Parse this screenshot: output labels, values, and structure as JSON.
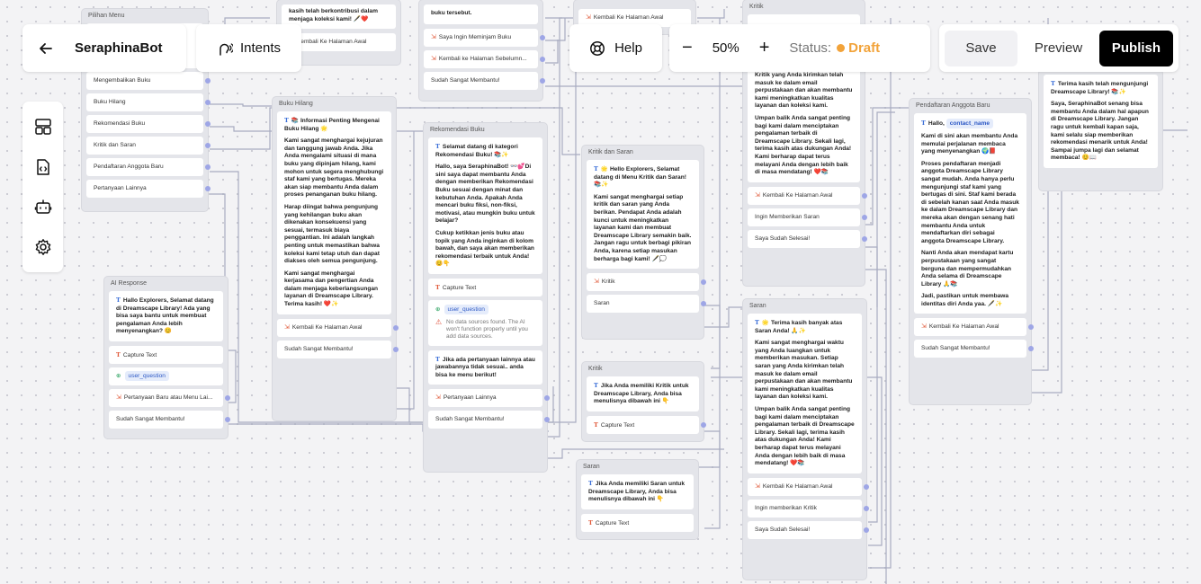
{
  "toolbar": {
    "back_icon": "arrow-left-icon",
    "bot_name": "SeraphinaBot",
    "intents_label": "Intents",
    "help_label": "Help",
    "zoom_minus": "−",
    "zoom_value": "50%",
    "zoom_plus": "+",
    "status_label": "Status:",
    "status_value": "Draft",
    "status_color": "#f2a33a",
    "save_label": "Save",
    "preview_label": "Preview",
    "publish_label": "Publish"
  },
  "rail": {
    "icons": [
      "layout-icon",
      "file-code-icon",
      "bot-icon",
      "gear-icon"
    ]
  },
  "nodes": {
    "pilihan_menu": {
      "title": "Pilihan Menu",
      "options": [
        "Mengembalikan Buku",
        "Buku Hilang",
        "Rekomendasi Buku",
        "Kritik dan Saran",
        "Pendaftaran Anggota Baru",
        "Pertanyaan Lainnya"
      ]
    },
    "top_a": {
      "text": "kasih telah berkontribusi dalam menjaga koleksi kami! 🖋️❤️",
      "option": "Kembali Ke Halaman Awal"
    },
    "top_b": {
      "text": "buku tersebut.",
      "options": [
        "Saya Ingin Meminjam Buku",
        "Kembali ke Halaman Sebelumn...",
        "Sudah Sangat Membantu!"
      ]
    },
    "top_c": {
      "option": "Kembali Ke Halaman Awal"
    },
    "top_d": {
      "title": "Kritik",
      "text_lines": [
        "Kritik yang Anda kirimkan telah masuk ke dalam email perpustakaan dan akan membantu kami meningkatkan kualitas layanan dan koleksi kami.",
        "Umpan balik Anda sangat penting bagi kami dalam menciptakan pengalaman terbaik di Dreamscape Library. Sekali lagi, terima kasih atas dukungan Anda! Kami berharap dapat terus melayani Anda dengan lebih baik di masa mendatang! ❤️📚"
      ],
      "options": [
        "Kembali Ke Halaman Awal",
        "Ingin Memberikan Saran",
        "Saya Sudah Selesai!"
      ]
    },
    "top_e": {
      "text": "Terima kasih telah mengunjungi Dreamscape Library! 📚✨",
      "text2": "Saya, SeraphinaBot senang bisa membantu Anda dalam hal apapun di Dreamscape Library. Jangan ragu untuk kembali kapan saja, kami selalu siap memberikan rekomendasi menarik untuk Anda! Sampai jumpa lagi dan selamat membaca! 😊📖"
    },
    "buku_hilang": {
      "title": "Buku Hilang",
      "text_lead": "📚 Informasi Penting Mengenai Buku Hilang 🌟",
      "paras": [
        "Kami sangat menghargai kejujuran dan tanggung jawab Anda. Jika Anda mengalami situasi di mana buku yang dipinjam hilang, kami mohon untuk segera menghubungi staf kami yang bertugas. Mereka akan siap membantu Anda dalam proses penanganan buku hilang.",
        "Harap diingat bahwa pengunjung yang kehilangan buku akan dikenakan konsekuensi yang sesuai, termasuk biaya penggantian. Ini adalah langkah penting untuk memastikan bahwa koleksi kami tetap utuh dan dapat diakses oleh semua pengunjung.",
        "Kami sangat menghargai kerjasama dan pengertian Anda dalam menjaga keberlangsungan layanan di Dreamscape Library. Terima kasih! ❤️✨"
      ],
      "options": [
        "Kembali Ke Halaman Awal",
        "Sudah Sangat Membantu!"
      ]
    },
    "ai_response": {
      "title": "AI Response",
      "text": "Hallo Explorers, Selamat datang di Dreamscape Library! Ada yang bisa saya bantu untuk membuat pengalaman Anda lebih menyenangkan? 😊",
      "capture": "Capture Text",
      "variable": "user_question",
      "options": [
        "Pertanyaan Baru atau Menu Lai...",
        "Sudah Sangat Membantu!"
      ]
    },
    "rekomendasi": {
      "title": "Rekomendasi Buku",
      "text_lead": "Selamat datang di kategori Rekomendasi Buku! 📚✨",
      "paras": [
        "Hallo, saya SeraphinaBot! 👓💕Di sini saya dapat membantu Anda dengan memberikan Rekomendasi Buku sesuai dengan minat dan kebutuhan Anda. Apakah Anda mencari buku fiksi, non-fiksi, motivasi, atau mungkin buku untuk belajar?",
        "Cukup ketikkan jenis buku atau topik yang Anda inginkan di kolom bawah, dan saya akan memberikan rekomendasi terbaik untuk Anda! 😊👇"
      ],
      "capture": "Capture Text",
      "variable": "user_question",
      "warning": "No data sources found. The AI won't function properly until you add data sources.",
      "text2": "Jika ada pertanyaan lainnya atau jawabannya tidak sesuai.. anda bisa ke menu berikut!",
      "options": [
        "Pertanyaan Lainnya",
        "Sudah Sangat Membantu!"
      ]
    },
    "kritik_saran": {
      "title": "Kritik dan Saran",
      "text_lead": "🌟 Hello Explorers, Selamat datang di Menu Kritik dan Saran! 📚✨",
      "paras": [
        "Kami sangat menghargai setiap kritik dan saran yang Anda berikan. Pendapat Anda adalah kunci untuk meningkatkan layanan kami dan membuat Dreamscape Library semakin baik. Jangan ragu untuk berbagi pikiran Anda, karena setiap masukan berharga bagi kami! 🖋️💭"
      ],
      "options": [
        "Kritik",
        "Saran"
      ]
    },
    "kritik": {
      "title": "Kritik",
      "text": "Jika Anda memiliki Kritik untuk Dreamscape Library, Anda bisa menulisnya dibawah ini 👇",
      "capture": "Capture Text"
    },
    "saran_small": {
      "title": "Saran",
      "text": "Jika Anda memiliki Saran untuk Dreamscape Library, Anda bisa menulisnya dibawah ini 👇",
      "capture": "Capture Text"
    },
    "saran": {
      "title": "Saran",
      "text_lead": "🌟 Terima kasih banyak atas Saran Anda! 🙏✨",
      "paras": [
        "Kami sangat menghargai waktu yang Anda luangkan untuk memberikan masukan. Setiap saran yang Anda kirimkan telah masuk ke dalam email perpustakaan dan akan membantu kami meningkatkan kualitas layanan dan koleksi kami.",
        "Umpan balik Anda sangat penting bagi kami dalam menciptakan pengalaman terbaik di Dreamscape Library. Sekali lagi, terima kasih atas dukungan Anda! Kami berharap dapat terus melayani Anda dengan lebih baik di masa mendatang! ❤️📚"
      ],
      "options": [
        "Kembali Ke Halaman Awal",
        "Ingin memberikan Kritik",
        "Saya Sudah Selesai!"
      ]
    },
    "pendaftaran": {
      "title": "Pendaftaran Anggota Baru",
      "hello": "Hallo,",
      "variable": "contact_name",
      "paras": [
        "Kami di sini akan membantu Anda memulai perjalanan membaca yang menyenangkan 🌍📕",
        "Proses pendaftaran menjadi anggota Dreamscape Library sangat mudah. Anda hanya perlu mengunjungi staf kami yang bertugas di sini. Staf kami berada di sebelah kanan saat Anda masuk ke dalam Dreamscape Library dan mereka akan dengan senang hati membantu Anda untuk mendaftarkan diri sebagai anggota Dreamscape Library.",
        "Nanti Anda akan mendapat kartu perpustakaan yang sangat berguna dan mempermudahkan Anda selama di Dreamscape Library 🙏📚",
        "Jadi, pastikan untuk membawa identitas diri Anda yaa. 🖋️✨"
      ],
      "options": [
        "Kembali Ke Halaman Awal",
        "Sudah Sangat Membantu!"
      ]
    }
  }
}
